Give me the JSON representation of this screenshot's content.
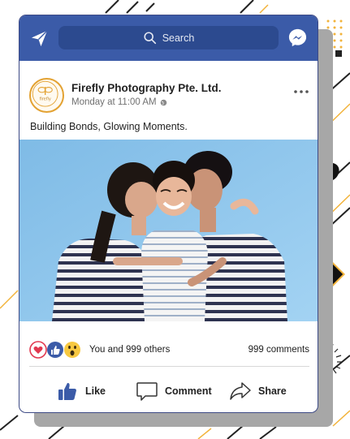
{
  "topbar": {
    "search_placeholder": "Search",
    "icons": [
      "paper-plane-icon",
      "search-icon",
      "messenger-icon"
    ],
    "bar_color": "#3b5ba8"
  },
  "post": {
    "page_name": "Firefly Photography Pte. Ltd.",
    "timestamp": "Monday at 11:00 AM",
    "caption": "Building Bonds, Glowing Moments.",
    "logo_text": "firefly",
    "reactions_text": "You and 999 others",
    "comments_text": "999 comments",
    "reaction_icons": [
      "love-reaction-icon",
      "like-reaction-icon",
      "wow-reaction-icon"
    ]
  },
  "actions": {
    "like_label": "Like",
    "comment_label": "Comment",
    "share_label": "Share"
  },
  "colors": {
    "brand_blue": "#3b5ba8",
    "accent_gold": "#f2b33a",
    "photo_bg": "#8fc7ee"
  }
}
